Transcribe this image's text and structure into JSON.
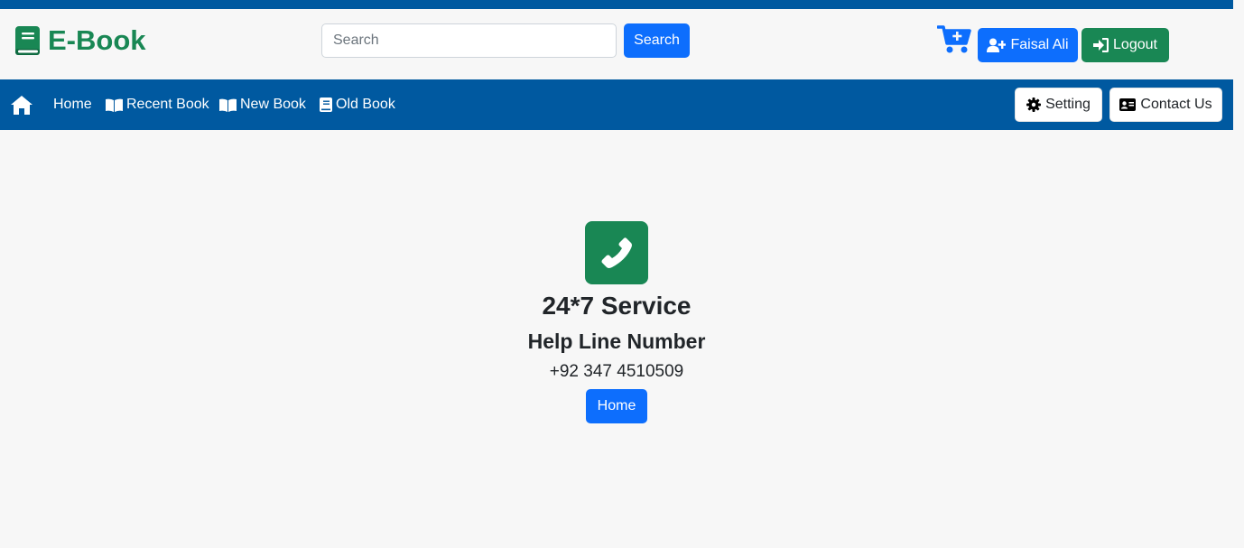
{
  "header": {
    "brand": {
      "title": "E-Book",
      "icon": "book-icon",
      "color": "#198754"
    },
    "search": {
      "placeholder": "Search",
      "value": "",
      "button_label": "Search"
    },
    "cart_icon": "cart-plus-icon",
    "user_button": {
      "label": "Faisal Ali",
      "icon": "user-plus-icon"
    },
    "logout_button": {
      "label": "Logout",
      "icon": "sign-in-icon"
    }
  },
  "navbar": {
    "home_icon": "home-icon",
    "items": [
      {
        "label": "Home",
        "icon": ""
      },
      {
        "label": "Recent Book",
        "icon": "book-open-icon"
      },
      {
        "label": "New Book",
        "icon": "book-open-icon"
      },
      {
        "label": "Old Book",
        "icon": "book-icon"
      }
    ],
    "setting_button": {
      "label": "Setting",
      "icon": "gear-icon"
    },
    "contact_button": {
      "label": "Contact Us",
      "icon": "id-card-icon"
    }
  },
  "main": {
    "phone_icon": "phone-icon",
    "service_title": "24*7 Service",
    "helpline_title": "Help Line Number",
    "phone_number": "+92 347 4510509",
    "home_button_label": "Home"
  },
  "colors": {
    "navbar": "#0059a0",
    "primary": "#0d6efd",
    "success": "#198754",
    "background": "#f7f7f7"
  }
}
